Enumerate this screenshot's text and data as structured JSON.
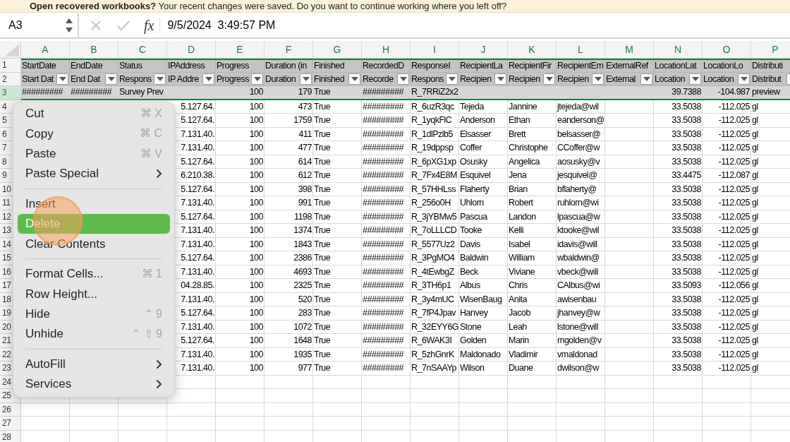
{
  "banner": {
    "text": "**Open recovered workbooks?**  Your recent changes were saved. Do you want to continue working where you left off?"
  },
  "formula_bar": {
    "name_box": "A3",
    "function_button": "fx",
    "value": "9/5/2024  3:49:57 PM"
  },
  "columns": [
    "A",
    "B",
    "C",
    "D",
    "E",
    "F",
    "G",
    "H",
    "I",
    "J",
    "K",
    "L",
    "M",
    "N",
    "O",
    "P"
  ],
  "header_rows": [
    {
      "number": "1",
      "filter": false,
      "cells": {
        "A": "StartDate",
        "B": "EndDate",
        "C": "Status",
        "D": "IPAddress",
        "E": "Progress",
        "F": "Duration (in",
        "G": "Finished",
        "H": "RecordedD",
        "I": "ResponseI",
        "J": "RecipientLa",
        "K": "RecipientFir",
        "L": "RecipientEm",
        "M": "ExternalRef",
        "N": "LocationLat",
        "O": "LocationLo",
        "P": "Distributi"
      }
    },
    {
      "number": "2",
      "filter": true,
      "cells": {
        "A": "Start Dat",
        "B": "End Dat",
        "C": "Respons",
        "D": "IP Addre",
        "E": "Progress",
        "F": "Duration",
        "G": "Finished",
        "H": "Recorde",
        "I": "Respons",
        "J": "Recipien",
        "K": "Recipien",
        "L": "Recipien",
        "M": "External",
        "N": "Location",
        "O": "Location",
        "P": "Distribut"
      }
    }
  ],
  "rows": [
    {
      "number": "3",
      "selected": true,
      "cells": {
        "A": "#########",
        "B": "#########",
        "C": "Survey Prev",
        "E": "100",
        "F": "179",
        "G": "True",
        "H": "#########",
        "I": "R_7RRiZ2x2",
        "N": "39.7388",
        "O": "-104.987",
        "P": "preview"
      }
    },
    {
      "number": "4",
      "selected": false,
      "cells": {
        "D": "5.127.64.",
        "E": "100",
        "F": "473",
        "G": "True",
        "H": "#########",
        "I": "R_6uzR3qc",
        "J": "Tejeda",
        "K": "Jannine",
        "L": "jtejeda@wil",
        "N": "33.5038",
        "O": "-112.025",
        "P": "gl"
      }
    },
    {
      "number": "5",
      "selected": false,
      "cells": {
        "D": "5.127.64.",
        "E": "100",
        "F": "1759",
        "G": "True",
        "H": "#########",
        "I": "R_1yqkFlC",
        "J": "Anderson",
        "K": "Ethan",
        "L": "eanderson@",
        "N": "33.5038",
        "O": "-112.025",
        "P": "gl"
      }
    },
    {
      "number": "6",
      "selected": false,
      "cells": {
        "D": "7.131.40.",
        "E": "100",
        "F": "411",
        "G": "True",
        "H": "#########",
        "I": "R_1dlPzlb5",
        "J": "Elsasser",
        "K": "Brett",
        "L": "belsasser@",
        "N": "33.5038",
        "O": "-112.025",
        "P": "gl"
      }
    },
    {
      "number": "7",
      "selected": false,
      "cells": {
        "D": "7.131.40.",
        "E": "100",
        "F": "477",
        "G": "True",
        "H": "#########",
        "I": "R_19dppsp",
        "J": "Coffer",
        "K": "Christophe",
        "L": "CCoffer@w",
        "N": "33.5038",
        "O": "-112.025",
        "P": "gl"
      }
    },
    {
      "number": "8",
      "selected": false,
      "cells": {
        "D": "5.127.64.",
        "E": "100",
        "F": "614",
        "G": "True",
        "H": "#########",
        "I": "R_6pXG1xp",
        "J": "Osusky",
        "K": "Angelica",
        "L": "aosusky@v",
        "N": "33.5038",
        "O": "-112.025",
        "P": "gl"
      }
    },
    {
      "number": "9",
      "selected": false,
      "cells": {
        "D": "6.210.38.",
        "E": "100",
        "F": "612",
        "G": "True",
        "H": "#########",
        "I": "R_7Fx4E8M",
        "J": "Esquivel",
        "K": "Jena",
        "L": "jesquivel@",
        "N": "33.4475",
        "O": "-112.087",
        "P": "gl"
      }
    },
    {
      "number": "10",
      "selected": false,
      "cells": {
        "D": "5.127.64.",
        "E": "100",
        "F": "398",
        "G": "True",
        "H": "#########",
        "I": "R_57HHLss",
        "J": "Flaherty",
        "K": "Brian",
        "L": "bflaherty@",
        "N": "33.5038",
        "O": "-112.025",
        "P": "gl"
      }
    },
    {
      "number": "11",
      "selected": false,
      "cells": {
        "D": "7.131.40.",
        "E": "100",
        "F": "991",
        "G": "True",
        "H": "#########",
        "I": "R_256o0H",
        "J": "Uhlorn",
        "K": "Robert",
        "L": "ruhlorn@wi",
        "N": "33.5038",
        "O": "-112.025",
        "P": "gl"
      }
    },
    {
      "number": "12",
      "selected": false,
      "cells": {
        "D": "5.127.64.",
        "E": "100",
        "F": "1198",
        "G": "True",
        "H": "#########",
        "I": "R_3jYBMw5",
        "J": "Pascua",
        "K": "Landon",
        "L": "lpascua@w",
        "N": "33.5038",
        "O": "-112.025",
        "P": "gl"
      }
    },
    {
      "number": "13",
      "selected": false,
      "cells": {
        "D": "7.131.40.",
        "E": "100",
        "F": "1374",
        "G": "True",
        "H": "#########",
        "I": "R_7oLLLCD",
        "J": "Tooke",
        "K": "Kelli",
        "L": "ktooke@wil",
        "N": "33.5038",
        "O": "-112.025",
        "P": "gl"
      }
    },
    {
      "number": "14",
      "selected": false,
      "cells": {
        "D": "7.131.40.",
        "E": "100",
        "F": "1843",
        "G": "True",
        "H": "#########",
        "I": "R_5577Uz2",
        "J": "Davis",
        "K": "Isabel",
        "L": "idavis@will",
        "N": "33.5038",
        "O": "-112.025",
        "P": "gl"
      }
    },
    {
      "number": "15",
      "selected": false,
      "cells": {
        "D": "5.127.64.",
        "E": "100",
        "F": "2386",
        "G": "True",
        "H": "#########",
        "I": "R_3PgMO4",
        "J": "Baldwin",
        "K": "William",
        "L": "wbaldwin@",
        "N": "33.5038",
        "O": "-112.025",
        "P": "gl"
      }
    },
    {
      "number": "16",
      "selected": false,
      "cells": {
        "D": "7.131.40.",
        "E": "100",
        "F": "4693",
        "G": "True",
        "H": "#########",
        "I": "R_4tEwbgZ",
        "J": "Beck",
        "K": "Viviane",
        "L": "vbeck@will",
        "N": "33.5038",
        "O": "-112.025",
        "P": "gl"
      }
    },
    {
      "number": "17",
      "selected": false,
      "cells": {
        "D": "04.28.85.",
        "E": "100",
        "F": "2325",
        "G": "True",
        "H": "#########",
        "I": "R_3TH6p1",
        "J": "Albus",
        "K": "Chris",
        "L": "CAlbus@wi",
        "N": "33.5093",
        "O": "-112.056",
        "P": "gl"
      }
    },
    {
      "number": "18",
      "selected": false,
      "cells": {
        "D": "7.131.40.",
        "E": "100",
        "F": "520",
        "G": "True",
        "H": "#########",
        "I": "R_3y4mUC",
        "J": "WisenBaug",
        "K": "Anita",
        "L": "awisenbau",
        "N": "33.5038",
        "O": "-112.025",
        "P": "gl"
      }
    },
    {
      "number": "19",
      "selected": false,
      "cells": {
        "D": "5.127.64.",
        "E": "100",
        "F": "283",
        "G": "True",
        "H": "#########",
        "I": "R_7fP4Jpav",
        "J": "Hanvey",
        "K": "Jacob",
        "L": "jhanvey@w",
        "N": "33.5038",
        "O": "-112.025",
        "P": "gl"
      }
    },
    {
      "number": "20",
      "selected": false,
      "cells": {
        "D": "7.131.40.",
        "E": "100",
        "F": "1072",
        "G": "True",
        "H": "#########",
        "I": "R_32EYY6G",
        "J": "Stone",
        "K": "Leah",
        "L": "lstone@will",
        "N": "33.5038",
        "O": "-112.025",
        "P": "gl"
      }
    },
    {
      "number": "21",
      "selected": false,
      "cells": {
        "D": "5.127.64.",
        "E": "100",
        "F": "1648",
        "G": "True",
        "H": "#########",
        "I": "R_6WAK3I",
        "J": "Golden",
        "K": "Marin",
        "L": "mgolden@v",
        "N": "33.5038",
        "O": "-112.025",
        "P": "gl"
      }
    },
    {
      "number": "22",
      "selected": false,
      "cells": {
        "D": "7.131.40.",
        "E": "100",
        "F": "1935",
        "G": "True",
        "H": "#########",
        "I": "R_5zhGnrK",
        "J": "Maldonado",
        "K": "Vladimir",
        "L": "vmaldonad",
        "N": "33.5038",
        "O": "-112.025",
        "P": "gl"
      }
    },
    {
      "number": "23",
      "selected": false,
      "cells": {
        "D": "7.131.40.",
        "E": "100",
        "F": "977",
        "G": "True",
        "H": "#########",
        "I": "R_7nSAAYp",
        "J": "Wilson",
        "K": "Duane",
        "L": "dwilson@w",
        "N": "33.5038",
        "O": "-112.025",
        "P": "gl"
      }
    },
    {
      "number": "24",
      "selected": false
    },
    {
      "number": "25",
      "selected": false
    },
    {
      "number": "26",
      "selected": false
    },
    {
      "number": "27",
      "selected": false
    },
    {
      "number": "28",
      "selected": false
    }
  ],
  "context_menu": {
    "items": [
      {
        "kind": "item",
        "label": "Cut",
        "shortcut": "⌘ X",
        "submenu": false,
        "selected": false
      },
      {
        "kind": "item",
        "label": "Copy",
        "shortcut": "⌘ C",
        "submenu": false,
        "selected": false
      },
      {
        "kind": "item",
        "label": "Paste",
        "shortcut": "⌘ V",
        "submenu": false,
        "selected": false
      },
      {
        "kind": "item",
        "label": "Paste Special",
        "submenu": true,
        "selected": false
      },
      {
        "kind": "separator"
      },
      {
        "kind": "item",
        "label": "Insert",
        "submenu": false,
        "selected": false
      },
      {
        "kind": "item",
        "label": "Delete",
        "submenu": false,
        "selected": true
      },
      {
        "kind": "item",
        "label": "Clear Contents",
        "submenu": false,
        "selected": false
      },
      {
        "kind": "separator"
      },
      {
        "kind": "item",
        "label": "Format Cells...",
        "shortcut": "⌘ 1",
        "submenu": false,
        "selected": false
      },
      {
        "kind": "item",
        "label": "Row Height...",
        "submenu": false,
        "selected": false
      },
      {
        "kind": "item",
        "label": "Hide",
        "shortcut": "⌃ 9",
        "submenu": false,
        "selected": false
      },
      {
        "kind": "item",
        "label": "Unhide",
        "shortcut": "⌃ ⇧ 9",
        "submenu": false,
        "selected": false
      },
      {
        "kind": "separator"
      },
      {
        "kind": "item",
        "label": "AutoFill",
        "submenu": true,
        "selected": false
      },
      {
        "kind": "item",
        "label": "Services",
        "submenu": true,
        "selected": false
      }
    ]
  }
}
